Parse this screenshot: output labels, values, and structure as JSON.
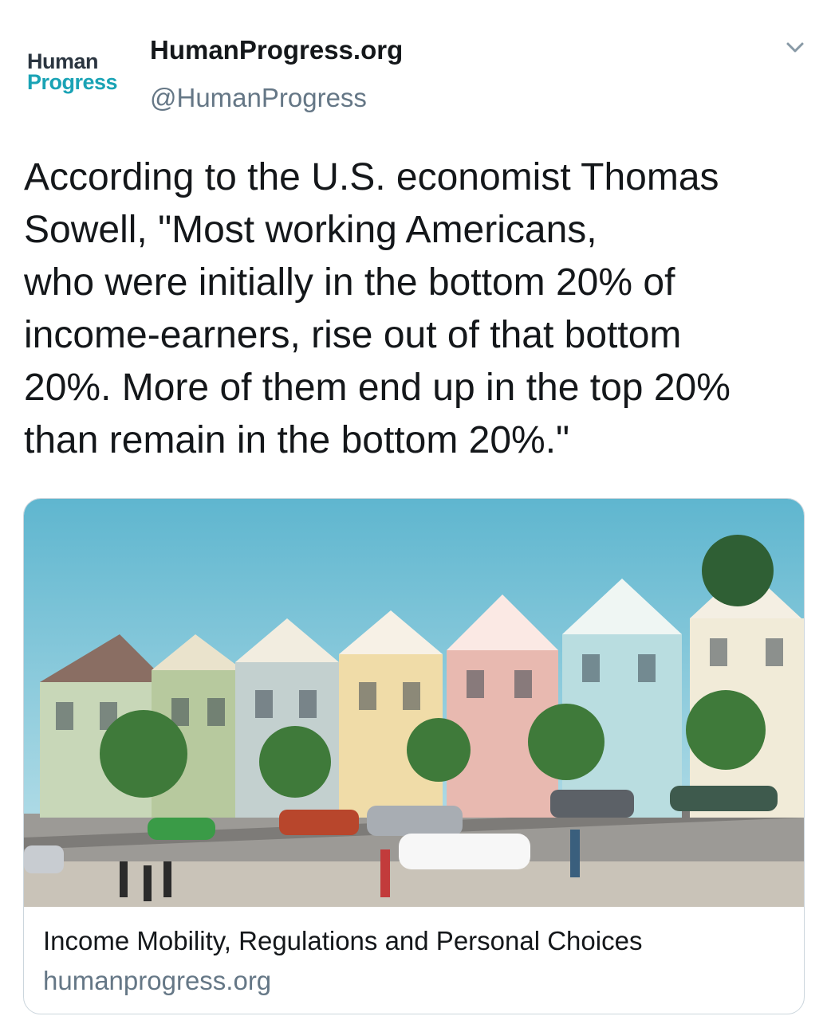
{
  "account": {
    "logo_line1": "Human",
    "logo_line2": "Progress",
    "display_name": "HumanProgress.org",
    "handle": "@HumanProgress"
  },
  "tweet": {
    "text": "According to the U.S. economist Thomas\nSowell, \"Most working Americans,\nwho were initially in the bottom 20% of\nincome-earners, rise out of that bottom\n20%. More of them end up in the top 20%\nthan remain in the bottom 20%.\""
  },
  "card": {
    "title": "Income Mobility, Regulations and Personal Choices",
    "domain": "humanprogress.org",
    "image_subject": "row of Victorian painted-lady houses with trees, parked cars and pedestrians"
  },
  "icons": {
    "caret": "chevron-down-icon"
  },
  "colors": {
    "text": "#14171a",
    "secondary": "#657786",
    "logo_dark": "#2b3540",
    "logo_teal": "#1aa3b5",
    "border": "#ccd6dd"
  }
}
